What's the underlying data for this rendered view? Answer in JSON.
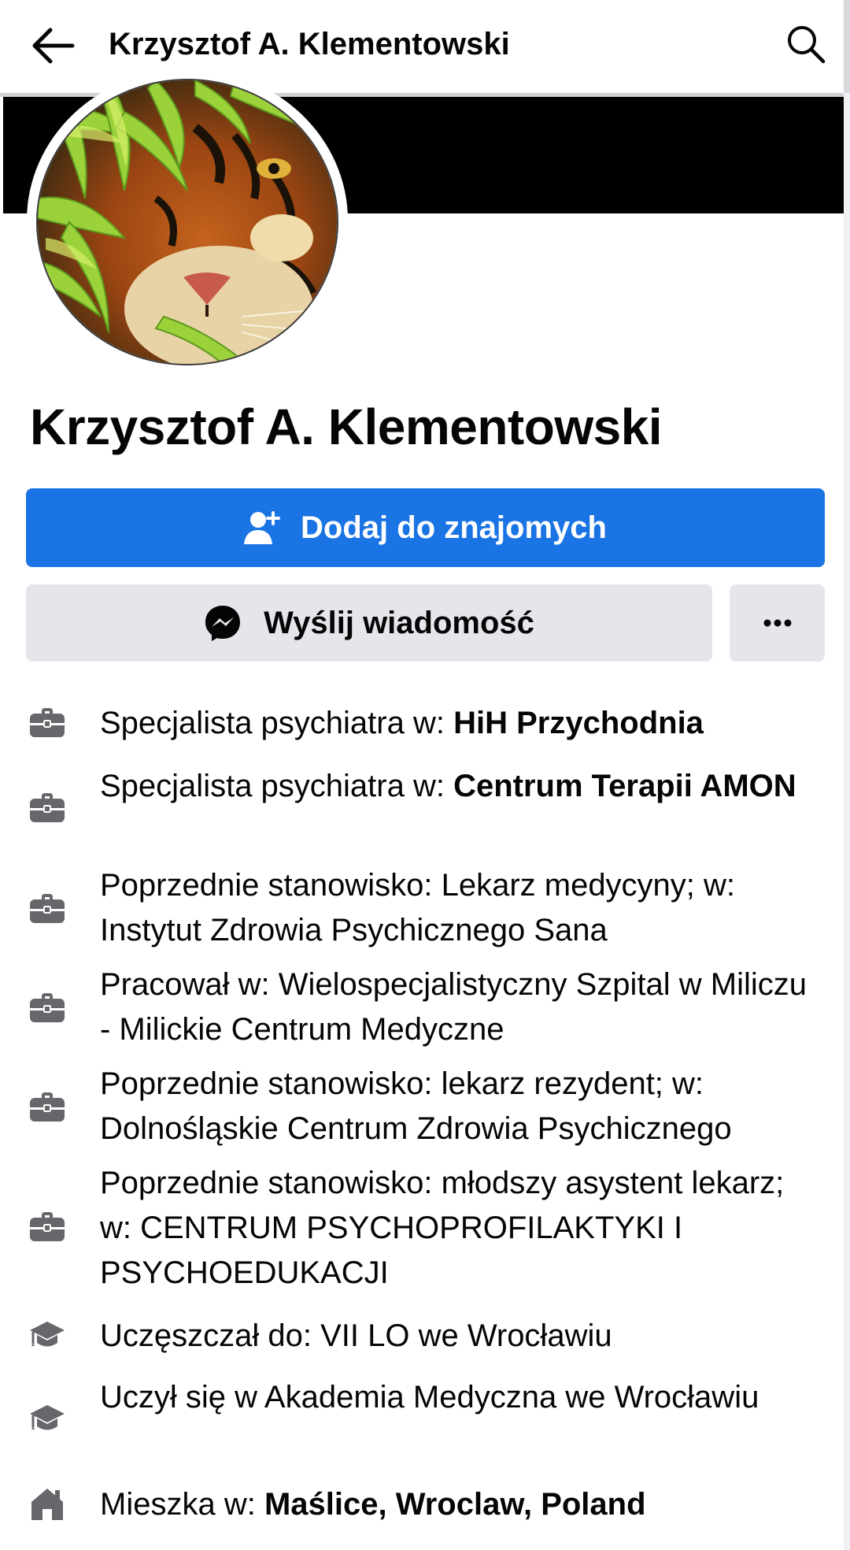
{
  "header": {
    "title": "Krzysztof A. Klementowski",
    "back_icon": "arrow-left-icon",
    "search_icon": "search-icon"
  },
  "profile": {
    "name": "Krzysztof A. Klementowski",
    "avatar": "tiger-in-bamboo-photo"
  },
  "actions": {
    "add_friend_label": "Dodaj do znajomych",
    "message_label": "Wyślij wiadomość",
    "more_label": "..."
  },
  "details": [
    {
      "icon": "briefcase-icon",
      "prefix": "Specjalista psychiatra w: ",
      "bold": "HiH Przychodnia"
    },
    {
      "icon": "briefcase-icon",
      "prefix": "Specjalista psychiatra w: ",
      "bold": "Centrum Terapii AMON"
    },
    {
      "icon": "briefcase-icon",
      "prefix": "Poprzednie stanowisko: Lekarz medycyny; w: Instytut Zdrowia Psychicznego Sana",
      "bold": ""
    },
    {
      "icon": "briefcase-icon",
      "prefix": "Pracował w: Wielospecjalistyczny Szpital w Miliczu - Milickie Centrum Medyczne",
      "bold": ""
    },
    {
      "icon": "briefcase-icon",
      "prefix": "Poprzednie stanowisko: lekarz rezydent; w: Dolnośląskie Centrum Zdrowia Psychicznego",
      "bold": ""
    },
    {
      "icon": "briefcase-icon",
      "prefix": "Poprzednie stanowisko: młodszy asystent lekarz; w: CENTRUM PSYCHOPROFILAKTYKI I PSYCHOEDUKACJI",
      "bold": ""
    },
    {
      "icon": "graduation-cap-icon",
      "prefix": "Uczęszczał do: VII LO we Wrocławiu",
      "bold": ""
    },
    {
      "icon": "graduation-cap-icon",
      "prefix": "Uczył się w Akademia Medyczna we Wrocławiu",
      "bold": ""
    },
    {
      "icon": "home-icon",
      "prefix": "Mieszka w: ",
      "bold": "Maślice, Wroclaw, Poland"
    }
  ],
  "colors": {
    "primary": "#1b74e4",
    "secondary_bg": "#e4e6eb",
    "text": "#050505",
    "icon": "#65676b"
  }
}
